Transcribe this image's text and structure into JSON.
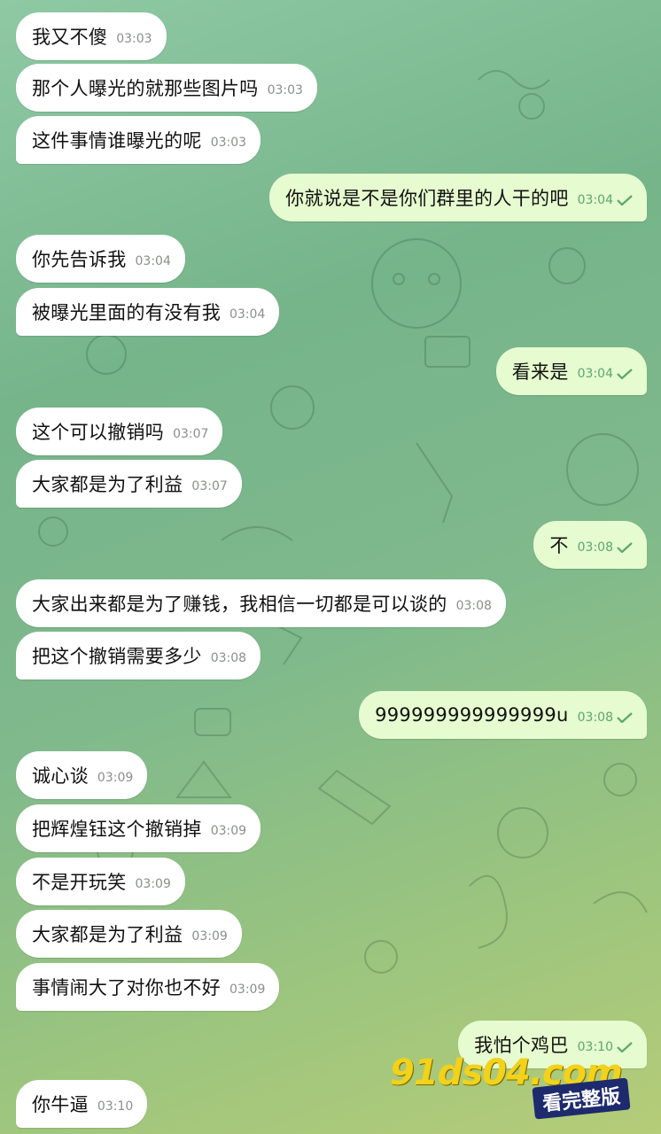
{
  "messages": [
    {
      "dir": "in",
      "text": "我又不傻",
      "time": "03:03"
    },
    {
      "dir": "in",
      "text": "那个人曝光的就那些图片吗",
      "time": "03:03"
    },
    {
      "dir": "in",
      "text": "这件事情谁曝光的呢",
      "time": "03:03"
    },
    {
      "dir": "out",
      "text": "你就说是不是你们群里的人干的吧",
      "time": "03:04"
    },
    {
      "dir": "in",
      "text": "你先告诉我",
      "time": "03:04"
    },
    {
      "dir": "in",
      "text": "被曝光里面的有没有我",
      "time": "03:04"
    },
    {
      "dir": "out",
      "text": "看来是",
      "time": "03:04"
    },
    {
      "dir": "in",
      "text": "这个可以撤销吗",
      "time": "03:07"
    },
    {
      "dir": "in",
      "text": "大家都是为了利益",
      "time": "03:07"
    },
    {
      "dir": "out",
      "text": "不",
      "time": "03:08"
    },
    {
      "dir": "in",
      "text": "大家出来都是为了赚钱，我相信一切都是可以谈的",
      "time": "03:08"
    },
    {
      "dir": "in",
      "text": "把这个撤销需要多少",
      "time": "03:08"
    },
    {
      "dir": "out",
      "text": "999999999999999u",
      "time": "03:08"
    },
    {
      "dir": "in",
      "text": "诚心谈",
      "time": "03:09"
    },
    {
      "dir": "in",
      "text": "把辉煌钰这个撤销掉",
      "time": "03:09"
    },
    {
      "dir": "in",
      "text": "不是开玩笑",
      "time": "03:09"
    },
    {
      "dir": "in",
      "text": "大家都是为了利益",
      "time": "03:09"
    },
    {
      "dir": "in",
      "text": "事情闹大了对你也不好",
      "time": "03:09"
    },
    {
      "dir": "out",
      "text": "我怕个鸡巴",
      "time": "03:10"
    },
    {
      "dir": "in",
      "text": "你牛逼",
      "time": "03:10"
    }
  ],
  "watermark": {
    "domain": "91ds04.com",
    "subtitle": "看完整版"
  },
  "colors": {
    "incoming": "#ffffff",
    "outgoing": "#e6fbcf",
    "check": "#5aa86a"
  }
}
